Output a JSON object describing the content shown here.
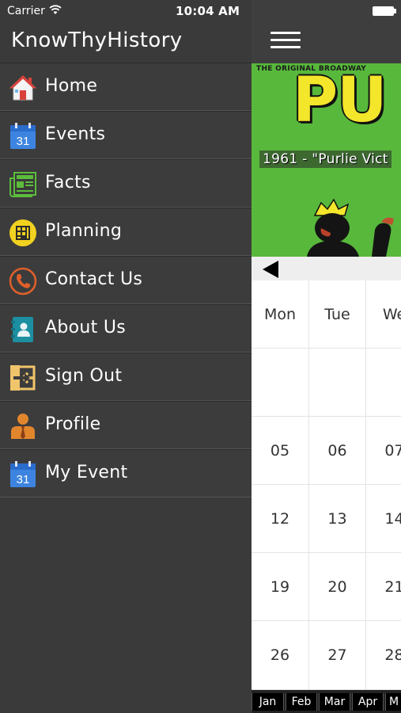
{
  "status_bar": {
    "carrier": "Carrier",
    "time": "10:04 AM"
  },
  "app": {
    "title": "KnowThyHistory"
  },
  "menu": [
    {
      "label": "Home",
      "icon": "home-icon"
    },
    {
      "label": "Events",
      "icon": "calendar-icon"
    },
    {
      "label": "Facts",
      "icon": "newspaper-icon"
    },
    {
      "label": "Planning",
      "icon": "planner-icon"
    },
    {
      "label": "Contact Us",
      "icon": "phone-icon"
    },
    {
      "label": "About Us",
      "icon": "contact-book-icon"
    },
    {
      "label": "Sign Out",
      "icon": "sign-out-icon"
    },
    {
      "label": "Profile",
      "icon": "person-icon"
    },
    {
      "label": "My Event",
      "icon": "calendar-icon"
    }
  ],
  "calendar_icon_text": "31",
  "banner": {
    "top_text": "THE ORIGINAL BROADWAY",
    "title_text": "PU",
    "caption": "1961 - \"Purlie Vict"
  },
  "calendar": {
    "weekdays": [
      "Mon",
      "Tue",
      "We"
    ],
    "weeks": [
      [
        "",
        "",
        ""
      ],
      [
        "05",
        "06",
        "07"
      ],
      [
        "12",
        "13",
        "14"
      ],
      [
        "19",
        "20",
        "21"
      ],
      [
        "26",
        "27",
        "28"
      ]
    ]
  },
  "months": [
    "Jan",
    "Feb",
    "Mar",
    "Apr",
    "M"
  ],
  "colors": {
    "drawer_bg": "#3a3a3a",
    "banner_green": "#58b83c",
    "banner_yellow": "#f3e62b"
  }
}
